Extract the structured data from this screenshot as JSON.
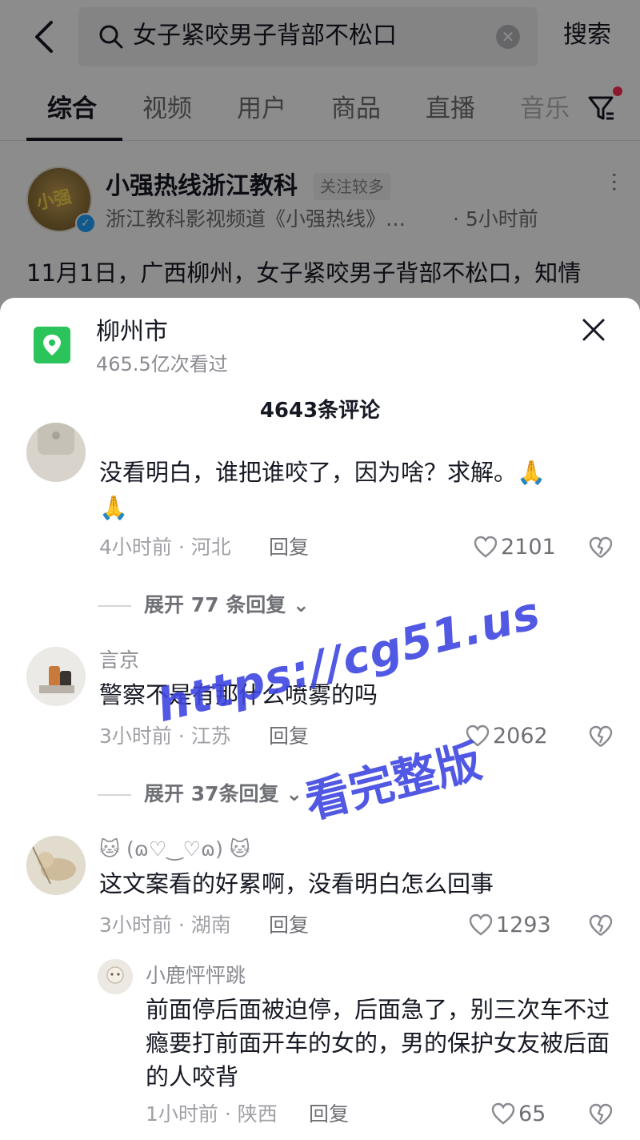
{
  "search": {
    "query": "女子紧咬男子背部不松口",
    "button": "搜索"
  },
  "tabs": [
    {
      "label": "综合",
      "active": true
    },
    {
      "label": "视频"
    },
    {
      "label": "用户"
    },
    {
      "label": "商品"
    },
    {
      "label": "直播"
    },
    {
      "label": "音乐"
    }
  ],
  "post": {
    "author": "小强热线浙江教科",
    "badge": "关注较多",
    "subtitle": "浙江教科影视频道《小强热线》…",
    "time": "· 5小时前",
    "text": "11月1日，广西柳州，女子紧咬男子背部不松口，知情"
  },
  "sheet": {
    "location": "柳州市",
    "views": "465.5亿次看过",
    "comment_count": "4643条评论"
  },
  "comments": [
    {
      "text_line1": "没看明白，谁把谁咬了，因为啥？求解。🙏",
      "text_line2": "🙏",
      "meta": "4小时前 · 河北",
      "reply": "回复",
      "likes": "2101",
      "expand": "展开 77 条回复"
    },
    {
      "user": "言京",
      "text": "警察不是有那什么喷雾的吗",
      "meta": "3小时前 · 江苏",
      "reply": "回复",
      "likes": "2062",
      "expand": "展开 37条回复"
    },
    {
      "user": "🐱 (ɷ♡‿♡ɷ) 🐱",
      "text": "这文案看的好累啊，没看明白怎么回事",
      "meta": "3小时前 · 湖南",
      "reply": "回复",
      "likes": "1293"
    }
  ],
  "sub_reply": {
    "user": "小鹿怦怦跳",
    "text": "前面停后面被迫停，后面急了，别三次车不过瘾要打前面开车的女的，男的保护女友被后面的人咬背",
    "meta": "1小时前 · 陕西",
    "reply": "回复",
    "likes": "65"
  },
  "watermark": {
    "line1": "https://cg51.us",
    "line2": "看完整版"
  },
  "colors": {
    "location_icon": "#2ac45a",
    "filter_dot": "#fe2c55",
    "verify": "#20a0ff",
    "watermark": "#3f46e0"
  }
}
